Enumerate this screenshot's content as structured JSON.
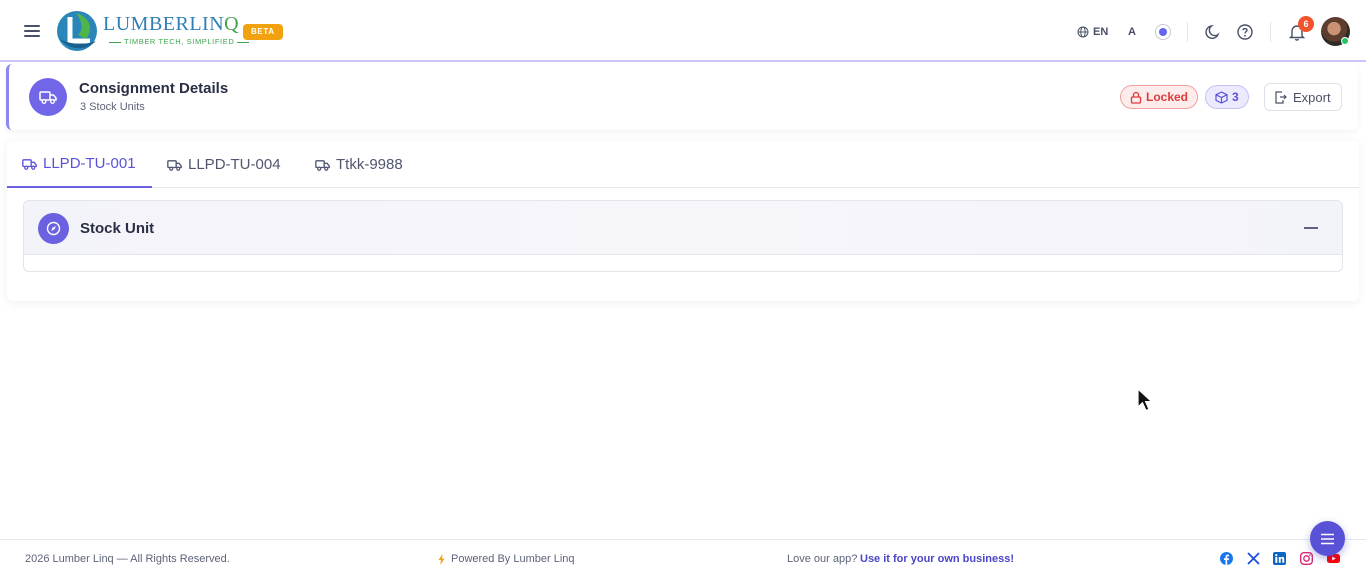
{
  "header": {
    "brand_name_main": "LUMBERLIN",
    "brand_name_q": "Q",
    "brand_tagline": "TIMBER TECH, SIMPLIFIED",
    "beta_label": "BETA",
    "language": "EN",
    "font_size_label": "A",
    "notification_count": "6",
    "icons": [
      "menu-icon",
      "globe-icon",
      "moon-icon",
      "help-icon",
      "bell-icon"
    ]
  },
  "details": {
    "title": "Consignment Details",
    "subtitle": "3 Stock Units",
    "locked_label": "Locked",
    "units_count": "3",
    "export_label": "Export"
  },
  "tabs": [
    {
      "label": "LLPD-TU-001",
      "active": true
    },
    {
      "label": "LLPD-TU-004",
      "active": false
    },
    {
      "label": "Ttkk-9988",
      "active": false
    }
  ],
  "section": {
    "title": "Stock Unit"
  },
  "footer": {
    "copyright": "2026 Lumber Linq — All Rights Reserved.",
    "powered": "Powered By Lumber Linq",
    "love": "Love our app?",
    "cta": "Use it for your own business!",
    "social": [
      "facebook-icon",
      "x-icon",
      "linkedin-icon",
      "instagram-icon",
      "youtube-icon"
    ]
  },
  "colors": {
    "accent": "#6a62e0",
    "beta": "#f2a20e",
    "locked": "#de3b3b",
    "notification": "#f0532d"
  }
}
